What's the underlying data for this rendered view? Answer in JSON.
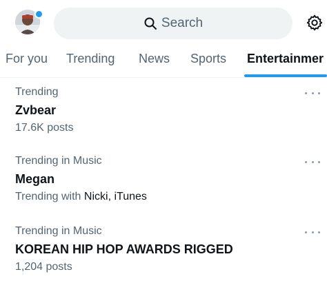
{
  "header": {
    "search_placeholder": "Search",
    "avatar_icon": "profile-avatar",
    "settings_icon": "gear-icon",
    "accent_color": "#1d9bf0"
  },
  "tabs": [
    {
      "label": "For you",
      "active": false
    },
    {
      "label": "Trending",
      "active": false
    },
    {
      "label": "News",
      "active": false
    },
    {
      "label": "Sports",
      "active": false
    },
    {
      "label": "Entertainmer",
      "active": true
    }
  ],
  "trends": [
    {
      "context": "Trending",
      "name": "Zvbear",
      "meta": "17.6K posts"
    },
    {
      "context": "Trending in Music",
      "name": "Megan",
      "meta_prefix": "Trending with",
      "meta_items": "Nicki, iTunes"
    },
    {
      "context": "Trending in Music",
      "name": "KOREAN HIP HOP AWARDS RIGGED",
      "meta": "1,204 posts"
    }
  ]
}
